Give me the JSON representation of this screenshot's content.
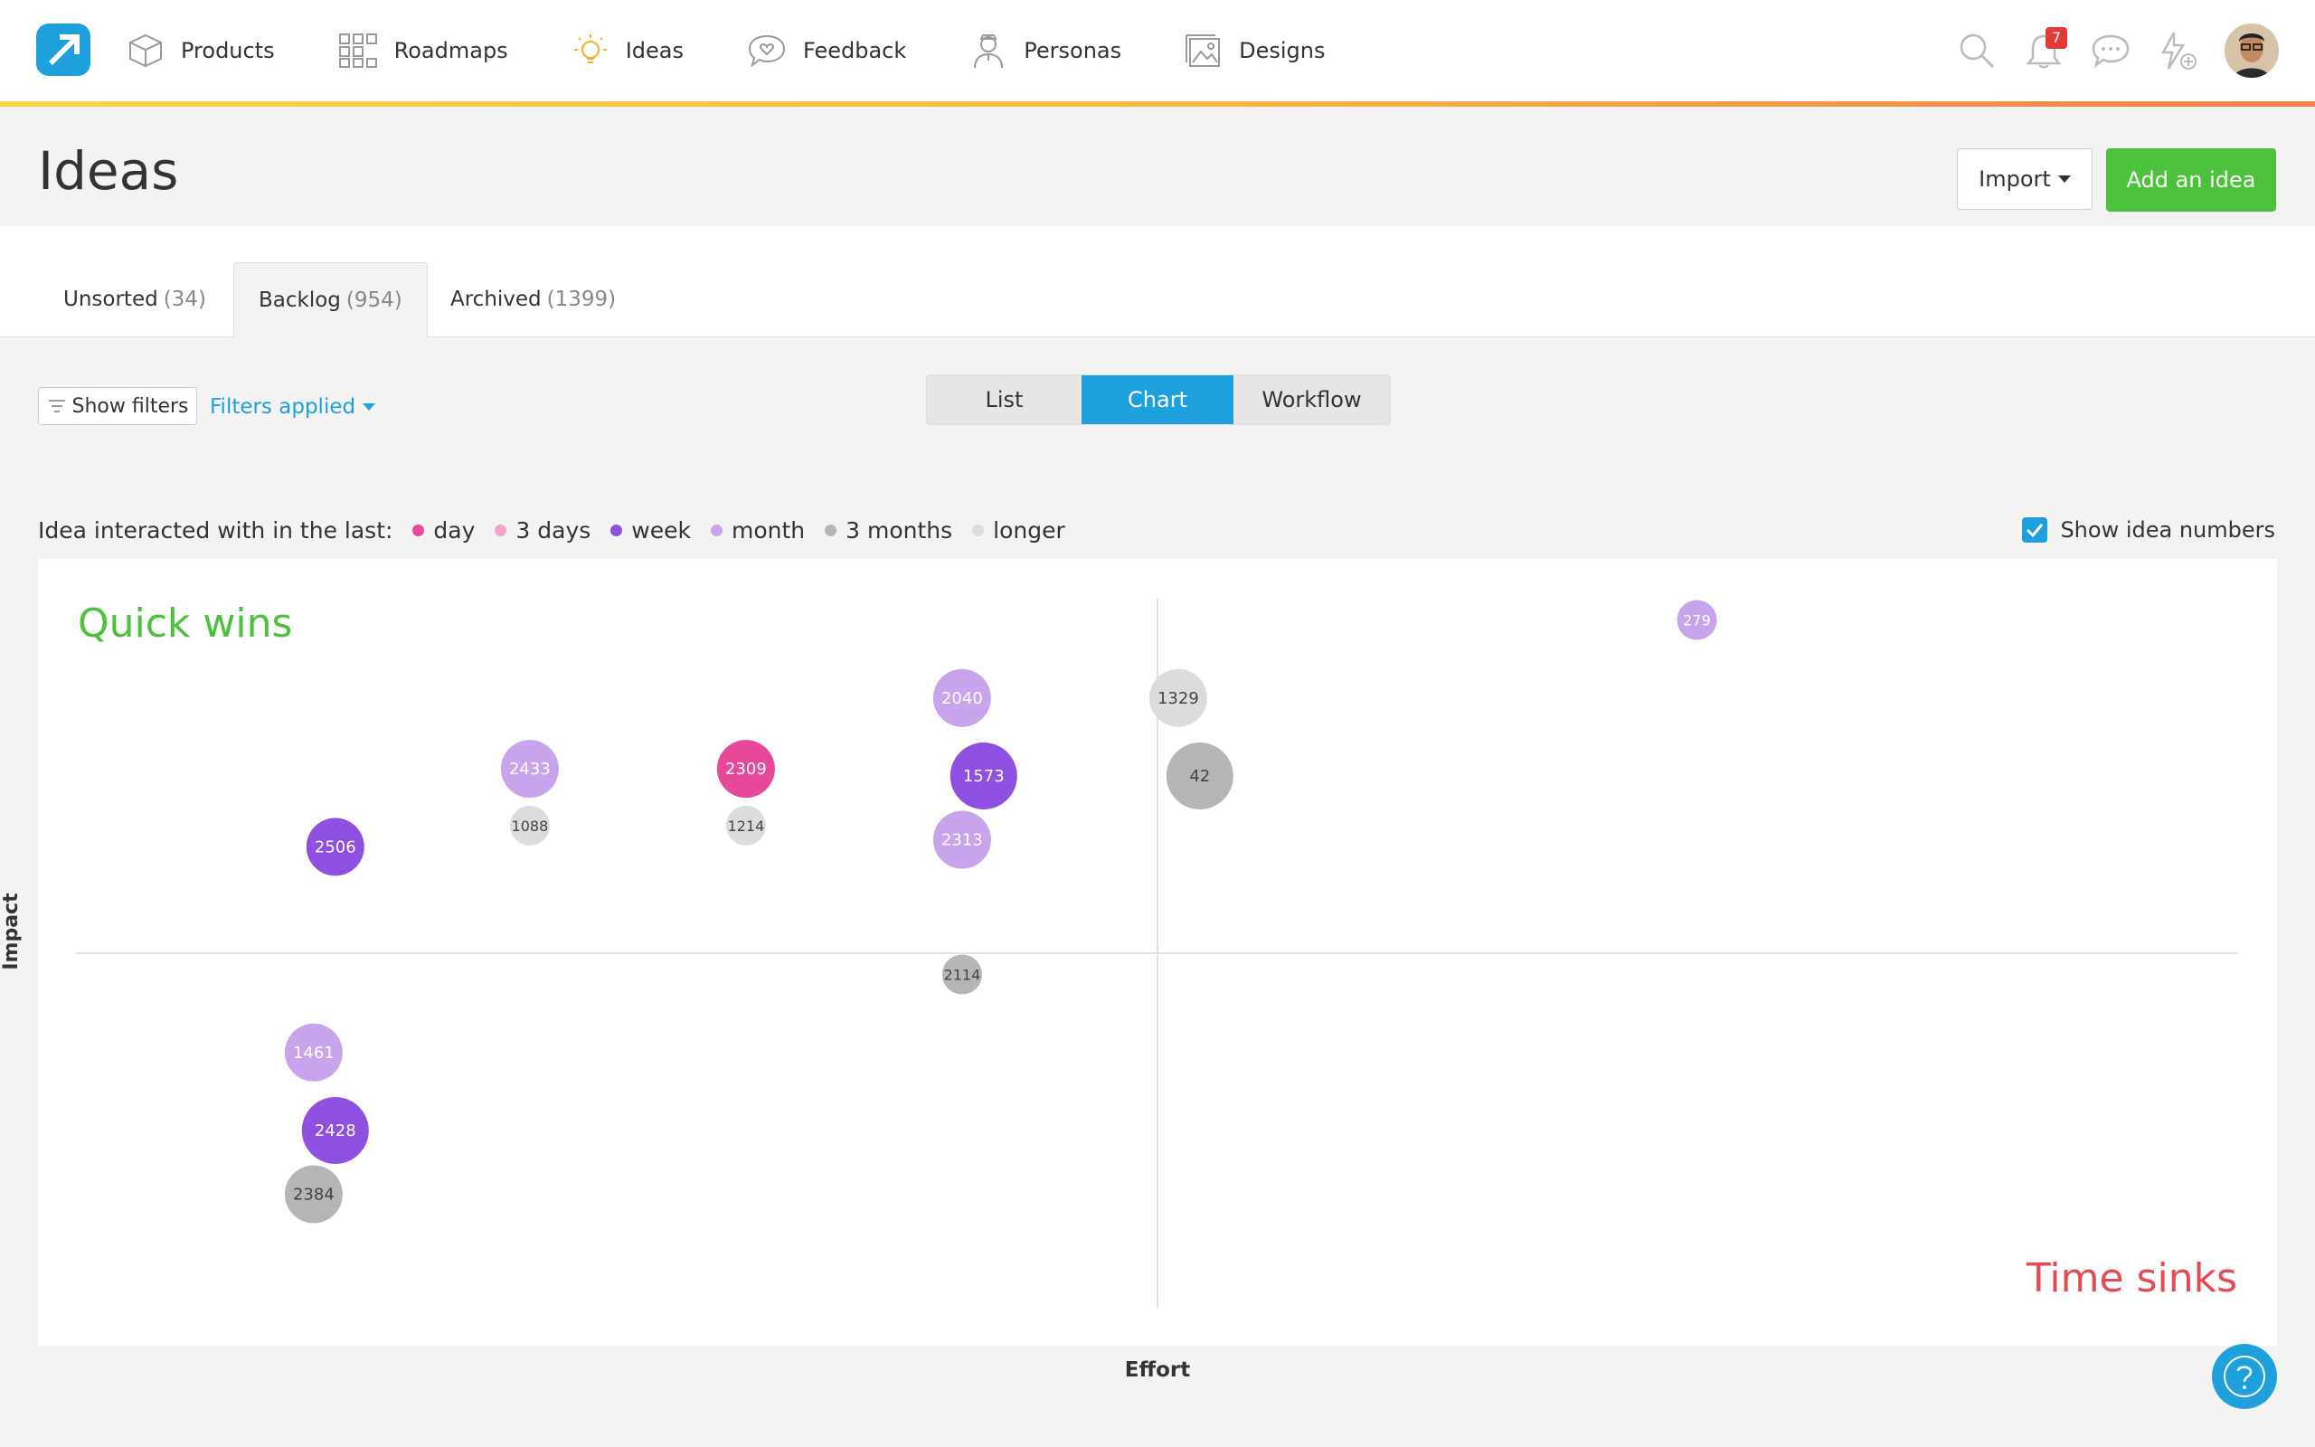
{
  "nav": {
    "items": [
      {
        "label": "Products",
        "icon": "box-icon"
      },
      {
        "label": "Roadmaps",
        "icon": "grid-icon"
      },
      {
        "label": "Ideas",
        "icon": "lightbulb-icon"
      },
      {
        "label": "Feedback",
        "icon": "speech-heart-icon"
      },
      {
        "label": "Personas",
        "icon": "person-icon"
      },
      {
        "label": "Designs",
        "icon": "image-icon"
      }
    ],
    "notifications_count": "7"
  },
  "page": {
    "title": "Ideas",
    "import_label": "Import",
    "add_label": "Add an idea"
  },
  "tabs": [
    {
      "label": "Unsorted",
      "count": "(34)"
    },
    {
      "label": "Backlog",
      "count": "(954)"
    },
    {
      "label": "Archived",
      "count": "(1399)"
    }
  ],
  "filters": {
    "show_label": "Show filters",
    "applied_label": "Filters applied"
  },
  "views": {
    "list": "List",
    "chart": "Chart",
    "workflow": "Workflow"
  },
  "legend": {
    "prefix": "Idea interacted with in the last:",
    "items": [
      {
        "label": "day",
        "color": "#e8489a"
      },
      {
        "label": "3 days",
        "color": "#f5a3cc"
      },
      {
        "label": "week",
        "color": "#8f4fe0"
      },
      {
        "label": "month",
        "color": "#c7a4ec"
      },
      {
        "label": "3 months",
        "color": "#b5b5b5"
      },
      {
        "label": "longer",
        "color": "#dcdcdc"
      }
    ],
    "show_numbers_label": "Show idea numbers"
  },
  "chart": {
    "quick_wins": "Quick wins",
    "time_sinks": "Time sinks",
    "x_label": "Effort",
    "y_label": "Impact"
  },
  "chart_data": {
    "type": "scatter",
    "xlabel": "Effort",
    "ylabel": "Impact",
    "points": [
      {
        "id": "279",
        "effort": 0.75,
        "impact": 0.97,
        "category": "month"
      },
      {
        "id": "2040",
        "effort": 0.41,
        "impact": 0.86,
        "category": "month"
      },
      {
        "id": "1329",
        "effort": 0.51,
        "impact": 0.86,
        "category": "longer"
      },
      {
        "id": "2433",
        "effort": 0.21,
        "impact": 0.76,
        "category": "month"
      },
      {
        "id": "2309",
        "effort": 0.31,
        "impact": 0.76,
        "category": "day"
      },
      {
        "id": "1573",
        "effort": 0.42,
        "impact": 0.75,
        "category": "week"
      },
      {
        "id": "42",
        "effort": 0.52,
        "impact": 0.75,
        "category": "3 months"
      },
      {
        "id": "1088",
        "effort": 0.21,
        "impact": 0.68,
        "category": "longer"
      },
      {
        "id": "1214",
        "effort": 0.31,
        "impact": 0.68,
        "category": "longer"
      },
      {
        "id": "2313",
        "effort": 0.41,
        "impact": 0.66,
        "category": "month"
      },
      {
        "id": "2506",
        "effort": 0.12,
        "impact": 0.65,
        "category": "week"
      },
      {
        "id": "2114",
        "effort": 0.41,
        "impact": 0.47,
        "category": "3 months"
      },
      {
        "id": "1461",
        "effort": 0.11,
        "impact": 0.36,
        "category": "month"
      },
      {
        "id": "2428",
        "effort": 0.12,
        "impact": 0.25,
        "category": "week"
      },
      {
        "id": "2384",
        "effort": 0.11,
        "impact": 0.16,
        "category": "3 months"
      }
    ],
    "sizes": {
      "279": 1,
      "2040": 2,
      "1329": 2,
      "2433": 2,
      "2309": 2,
      "1573": 3,
      "42": 3,
      "1088": 1,
      "1214": 1,
      "2313": 2,
      "2506": 2,
      "2114": 1,
      "1461": 2,
      "2428": 3,
      "2384": 2
    },
    "xlim": [
      0,
      1
    ],
    "ylim": [
      0,
      1
    ]
  }
}
